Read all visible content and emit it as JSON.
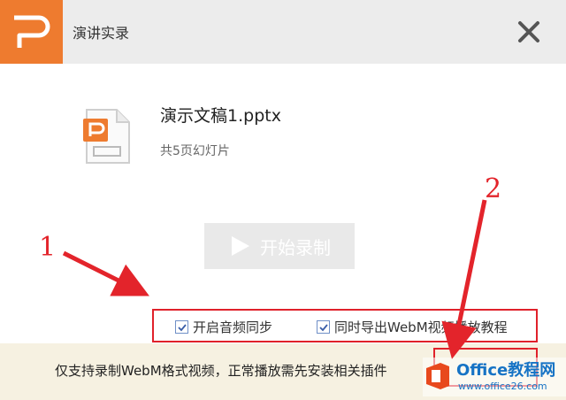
{
  "window": {
    "title": "演讲实录",
    "close_icon": "close-icon"
  },
  "file": {
    "name": "演示文稿1.pptx",
    "pages": "共5页幻灯片"
  },
  "start_button": {
    "label": "开始录制"
  },
  "options": {
    "sync_audio_label": "开启音频同步",
    "sync_audio_checked": true,
    "export_tutorial_label": "同时导出WebM视频播放教程",
    "export_tutorial_checked": true
  },
  "footer": {
    "notice": "仅支持录制WebM格式视频，正常播放需先安装相关插件"
  },
  "annotations": {
    "label_1": "1",
    "label_2": "2"
  },
  "watermark": {
    "title": "Office教程网",
    "url": "www.office26.com"
  },
  "colors": {
    "brand_orange": "#ee7b2f",
    "annotation_red": "#e3242b",
    "footer_bg": "#f6f1e1",
    "watermark_blue": "#1673c5"
  }
}
